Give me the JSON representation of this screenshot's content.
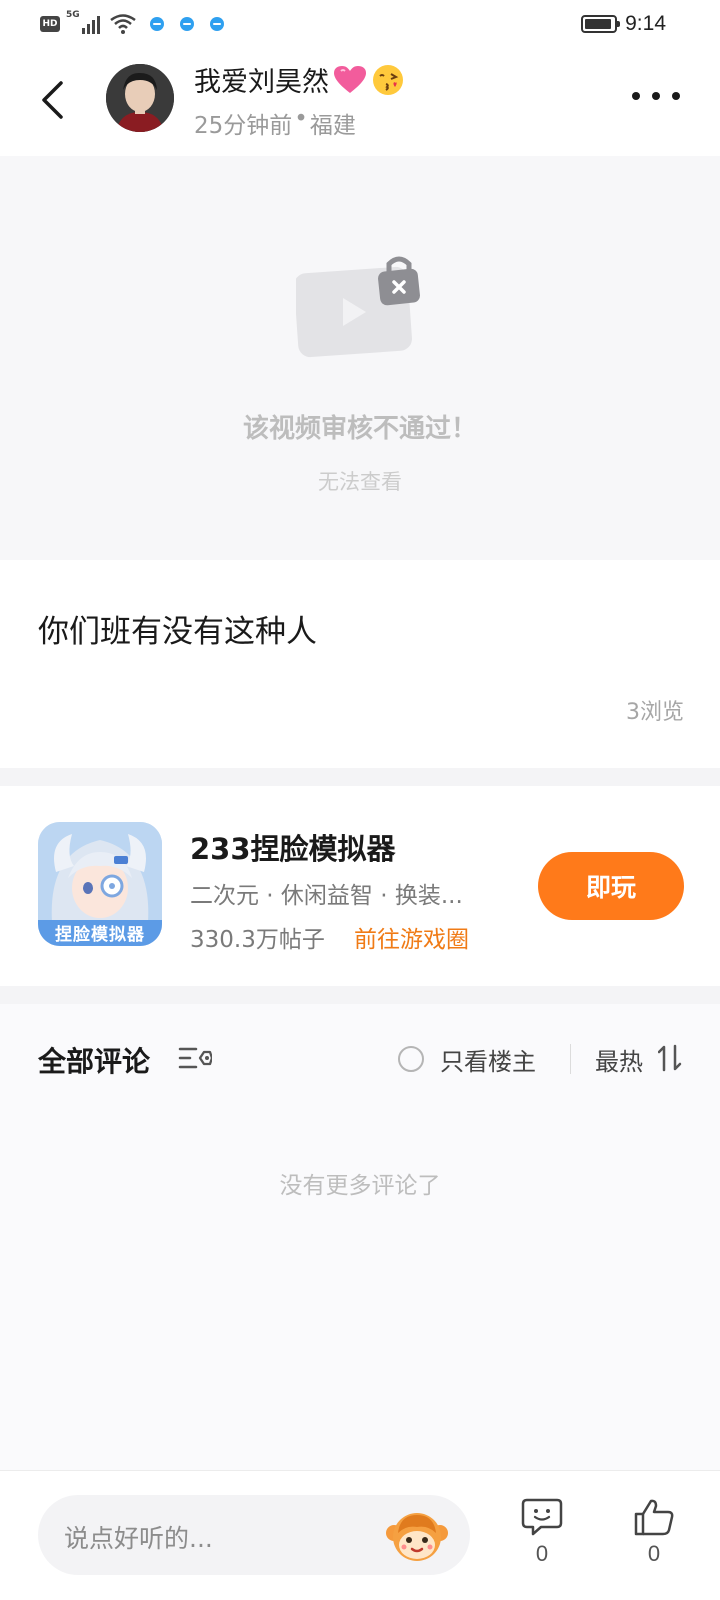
{
  "status_bar": {
    "hd": "HD",
    "network": "5G",
    "time": "9:14"
  },
  "header": {
    "author_name": "我爱刘昊然",
    "post_time": "25分钟前",
    "separator": "•",
    "location": "福建"
  },
  "video": {
    "blocked_title": "该视频审核不通过！",
    "blocked_subtitle": "无法查看"
  },
  "post": {
    "text": "你们班有没有这种人",
    "views": "3浏览"
  },
  "game_card": {
    "title": "233捏脸模拟器",
    "tags": "二次元 · 休闲益智 · 换装...",
    "post_count": "330.3万帖子",
    "link_label": "前往游戏圈",
    "play_label": "即玩",
    "icon_text": "捏脸模拟器"
  },
  "comments": {
    "title": "全部评论",
    "only_op_label": "只看楼主",
    "sort_label": "最热",
    "empty_text": "没有更多评论了"
  },
  "bottom_bar": {
    "input_placeholder": "说点好听的...",
    "comment_count": "0",
    "like_count": "0"
  },
  "colors": {
    "accent": "#ff7a1a",
    "link": "#f07b16",
    "placeholder_bg": "#f7f7f9",
    "status_bubbles": "#2fa0f0"
  }
}
